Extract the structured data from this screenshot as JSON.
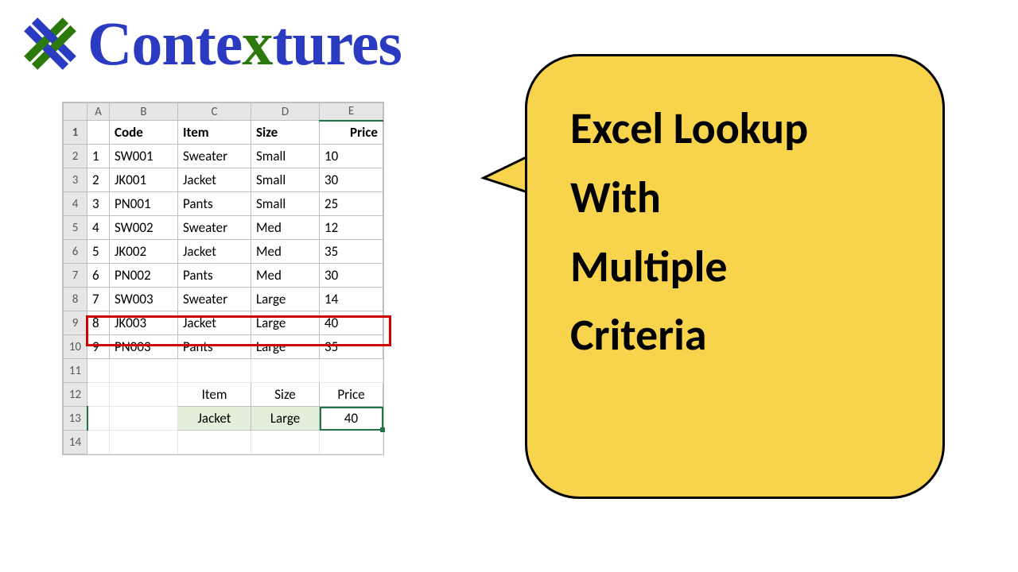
{
  "logo": {
    "text_pre": "Conte",
    "text_x": "x",
    "text_post": "tures"
  },
  "callout": {
    "line1": "Excel Lookup",
    "line2": "With",
    "line3": "Multiple",
    "line4": "Criteria"
  },
  "sheet": {
    "cols": [
      "A",
      "B",
      "C",
      "D",
      "E"
    ],
    "header": {
      "b": "Code",
      "c": "Item",
      "d": "Size",
      "e": "Price"
    },
    "rows": [
      {
        "n": "1",
        "a": "",
        "b": "Code",
        "c": "Item",
        "d": "Size",
        "e": "Price",
        "isHeader": true
      },
      {
        "n": "2",
        "a": "1",
        "b": "SW001",
        "c": "Sweater",
        "d": "Small",
        "e": "10"
      },
      {
        "n": "3",
        "a": "2",
        "b": "JK001",
        "c": "Jacket",
        "d": "Small",
        "e": "30"
      },
      {
        "n": "4",
        "a": "3",
        "b": "PN001",
        "c": "Pants",
        "d": "Small",
        "e": "25"
      },
      {
        "n": "5",
        "a": "4",
        "b": "SW002",
        "c": "Sweater",
        "d": "Med",
        "e": "12"
      },
      {
        "n": "6",
        "a": "5",
        "b": "JK002",
        "c": "Jacket",
        "d": "Med",
        "e": "35"
      },
      {
        "n": "7",
        "a": "6",
        "b": "PN002",
        "c": "Pants",
        "d": "Med",
        "e": "30"
      },
      {
        "n": "8",
        "a": "7",
        "b": "SW003",
        "c": "Sweater",
        "d": "Large",
        "e": "14"
      },
      {
        "n": "9",
        "a": "8",
        "b": "JK003",
        "c": "Jacket",
        "d": "Large",
        "e": "40"
      },
      {
        "n": "10",
        "a": "9",
        "b": "PN003",
        "c": "Pants",
        "d": "Large",
        "e": "35"
      },
      {
        "n": "11",
        "a": "",
        "b": "",
        "c": "",
        "d": "",
        "e": ""
      },
      {
        "n": "12",
        "a": "",
        "b": "",
        "c": "Item",
        "d": "Size",
        "e": "Price"
      },
      {
        "n": "13",
        "a": "",
        "b": "",
        "c": "Jacket",
        "d": "Large",
        "e": "40"
      },
      {
        "n": "14",
        "a": "",
        "b": "",
        "c": "",
        "d": "",
        "e": ""
      }
    ],
    "highlight_row_index": 8,
    "selected_row_label": "13",
    "selected_col_label": "E"
  }
}
